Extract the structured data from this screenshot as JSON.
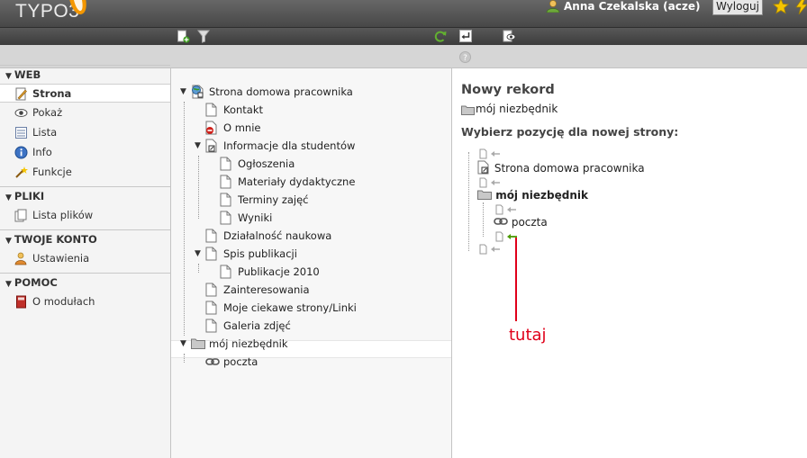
{
  "app": {
    "logo": "TYPO3"
  },
  "topbar": {
    "user_name": "Anna Czekalska (acze)",
    "logout_label": "Wyloguj"
  },
  "menu": {
    "sections": [
      {
        "label": "WEB",
        "items": [
          "Strona",
          "Pokaż",
          "Lista",
          "Info",
          "Funkcje"
        ]
      },
      {
        "label": "PLIKI",
        "items": [
          "Lista plików"
        ]
      },
      {
        "label": "TWOJE KONTO",
        "items": [
          "Ustawienia"
        ]
      },
      {
        "label": "POMOC",
        "items": [
          "O modułach"
        ]
      }
    ]
  },
  "tree": {
    "root": "Strona domowa pracownika",
    "items": [
      "Kontakt",
      "O mnie",
      "Informacje dla studentów",
      "Ogłoszenia",
      "Materiały dydaktyczne",
      "Terminy zajęć",
      "Wyniki",
      "Działalność naukowa",
      "Spis publikacji",
      "Publikacje 2010",
      "Zainteresowania",
      "Moje ciekawe strony/Linki",
      "Galeria zdjęć"
    ],
    "folder": "mój niezbędnik",
    "folder_child": "poczta"
  },
  "content": {
    "title": "Nowy rekord",
    "record_folder": "mój niezbędnik",
    "position_heading": "Wybierz pozycję dla nowej strony:",
    "pos_items": [
      "Strona domowa pracownika",
      "mój niezbędnik",
      "poczta"
    ],
    "annotation": "tutaj"
  },
  "colors": {
    "annotation": "#e0001a",
    "topbar": "#505050",
    "accent_arrow": "#4a9a00"
  }
}
